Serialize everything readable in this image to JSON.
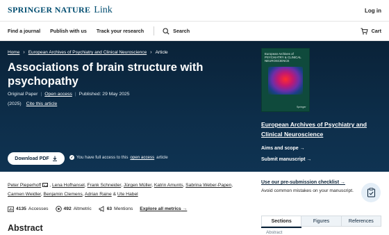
{
  "header": {
    "brand_primary": "SPRINGER NATURE",
    "brand_secondary": "Link",
    "login": "Log in"
  },
  "nav": {
    "items": [
      "Find a journal",
      "Publish with us",
      "Track your research"
    ],
    "search": "Search",
    "cart": "Cart"
  },
  "breadcrumb": [
    "Home",
    "European Archives of Psychiatry and Clinical Neuroscience",
    "Article"
  ],
  "article": {
    "title": "Associations of brain structure with psychopathy",
    "type": "Original Paper",
    "access": "Open access",
    "published": "Published: 29 May 2025",
    "year": "(2025)",
    "cite": "Cite this article",
    "download": "Download PDF",
    "access_note_prefix": "You have full access to this",
    "access_note_link": "open access",
    "access_note_suffix": "article"
  },
  "journal": {
    "cover_title": "European Archives of PSYCHIATRY & CLINICAL NEUROSCIENCE",
    "cover_publisher": "Springer",
    "name": "European Archives of Psychiatry and Clinical Neuroscience",
    "aims": "Aims and scope",
    "submit": "Submit manuscript"
  },
  "authors": [
    "Peter Pieperhoff",
    "Lena Hofhansel",
    "Frank Schneider",
    "Jürgen Müller",
    "Katrin Amunts",
    "Sabrina Weber-Papen",
    "Carmen Weidler",
    "Benjamin Clemens",
    "Adrian Raine",
    "Ute Habel"
  ],
  "metrics": {
    "accesses_count": "4135",
    "accesses_label": "Accesses",
    "altmetric_count": "492",
    "altmetric_label": "Altmetric",
    "mentions_count": "63",
    "mentions_label": "Mentions",
    "explore": "Explore all metrics"
  },
  "abstract_heading": "Abstract",
  "checklist": {
    "title": "Use our pre-submission checklist",
    "desc": "Avoid common mistakes on your manuscript."
  },
  "tabs": [
    "Sections",
    "Figures",
    "References"
  ],
  "section_peek": "Abstract",
  "colors": {
    "hero": "#0d2e4a",
    "brand": "#024e71"
  }
}
